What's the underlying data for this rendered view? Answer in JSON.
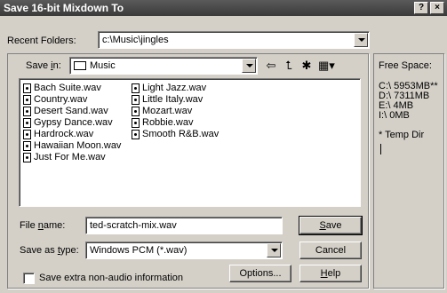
{
  "window": {
    "title": "Save 16-bit Mixdown To",
    "help_btn": "?",
    "close_btn": "×"
  },
  "recent": {
    "label_prefix": "Recent Folders:",
    "value": "c:\\Music\\jingles"
  },
  "savein": {
    "label_pre": "Save ",
    "label_ul": "i",
    "label_post": "n:",
    "folder": "Music"
  },
  "toolbar": {
    "back_icon": "back-arrow-icon",
    "up_icon": "folder-up-icon",
    "new_icon": "new-folder-icon",
    "view_icon": "view-menu-icon"
  },
  "files": {
    "col1": [
      "Bach Suite.wav",
      "Country.wav",
      "Desert Sand.wav",
      "Gypsy Dance.wav",
      "Hardrock.wav",
      "Hawaiian Moon.wav",
      "Just For Me.wav"
    ],
    "col2": [
      "Light Jazz.wav",
      "Little Italy.wav",
      "Mozart.wav",
      "Robbie.wav",
      "Smooth R&B.wav"
    ]
  },
  "filename": {
    "label_pre": "File ",
    "label_ul": "n",
    "label_post": "ame:",
    "value": "ted-scratch-mix.wav"
  },
  "savetype": {
    "label_pre": "Save as ",
    "label_ul": "t",
    "label_post": "ype:",
    "value": "Windows PCM (*.wav)"
  },
  "buttons": {
    "save_ul": "S",
    "save_rest": "ave",
    "cancel": "Cancel",
    "options": "Options...",
    "help_ul": "H",
    "help_rest": "elp"
  },
  "checkbox": {
    "label": "Save extra non-audio information",
    "checked": false
  },
  "sidebar": {
    "title": "Free Space:",
    "drives": [
      "C:\\  5953MB**",
      "D:\\  7311MB",
      "E:\\  4MB",
      "I:\\  0MB"
    ],
    "note": "* Temp Dir"
  }
}
